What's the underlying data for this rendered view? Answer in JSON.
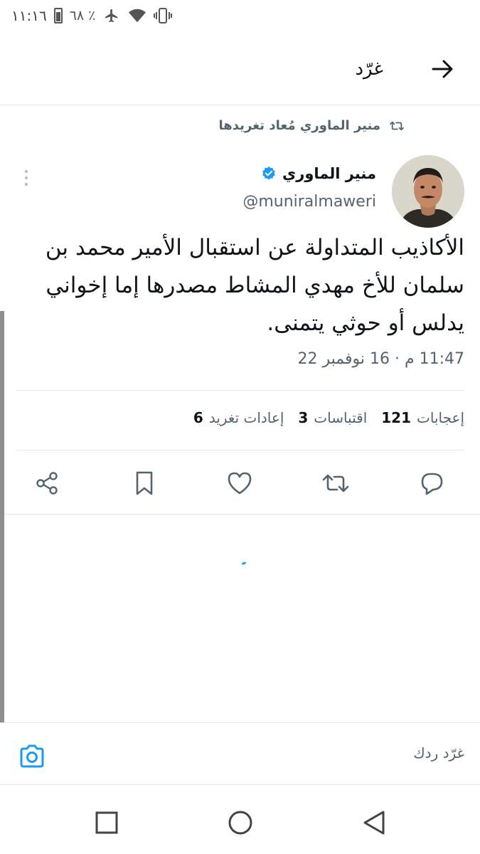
{
  "status_bar": {
    "time": "١١:١٦",
    "battery": "٦٨ ٪"
  },
  "header": {
    "title": "غرّد"
  },
  "retweet_context": {
    "text": "منير الماوري مُعاد تغريدها"
  },
  "author": {
    "name": "منير الماوري",
    "handle": "@muniralmaweri",
    "verified": true
  },
  "tweet": {
    "text": "الأكاذيب المتداولة عن استقبال الأمير محمد بن سلمان للأخ مهدي المشاط مصدرها إما إخواني يدلس أو حوثي يتمنى.",
    "meta": "11:47 م · 16 نوفمبر 22"
  },
  "stats": {
    "retweets": {
      "count": "6",
      "label": "إعادات تغريد"
    },
    "quotes": {
      "count": "3",
      "label": "اقتباسات"
    },
    "likes": {
      "count": "121",
      "label": "إعجابات"
    }
  },
  "composer": {
    "placeholder": "غرّد ردك"
  },
  "colors": {
    "accent": "#1d9bf0",
    "text": "#0f1419",
    "secondary": "#536471"
  }
}
